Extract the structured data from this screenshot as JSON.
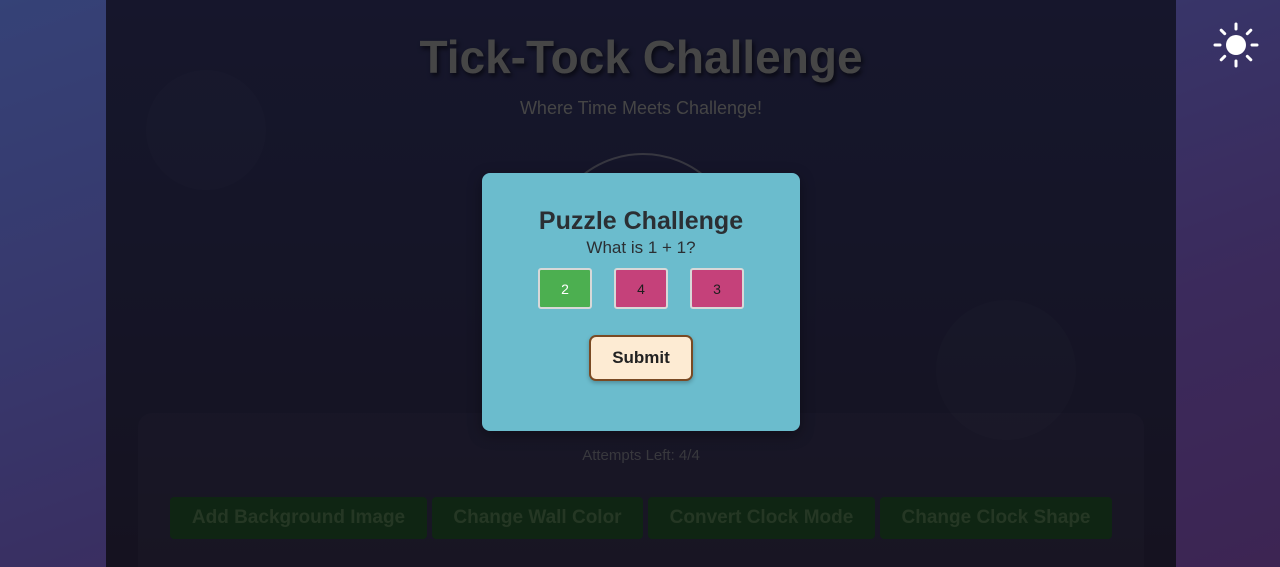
{
  "app": {
    "title": "Tick-Tock Challenge",
    "subtitle": "Where Time Meets Challenge!"
  },
  "controls": {
    "attempts_text": "Attempts Left: 4/4",
    "buttons": [
      {
        "label": "Add Background Image"
      },
      {
        "label": "Change Wall Color"
      },
      {
        "label": "Convert Clock Mode"
      },
      {
        "label": "Change Clock Shape"
      }
    ]
  },
  "theme_toggle": {
    "icon": "sun-icon"
  },
  "modal": {
    "title": "Puzzle Challenge",
    "question": "What is 1 + 1?",
    "options": [
      {
        "label": "2",
        "state": "correct"
      },
      {
        "label": "4",
        "state": "wrong"
      },
      {
        "label": "3",
        "state": "wrong"
      }
    ],
    "submit_label": "Submit"
  },
  "colors": {
    "modal_bg": "#6bbccd",
    "correct_option": "#4caf50",
    "wrong_option": "#c5417a",
    "submit_bg": "#fdebd3",
    "control_button_bg": "#1f4a26"
  }
}
